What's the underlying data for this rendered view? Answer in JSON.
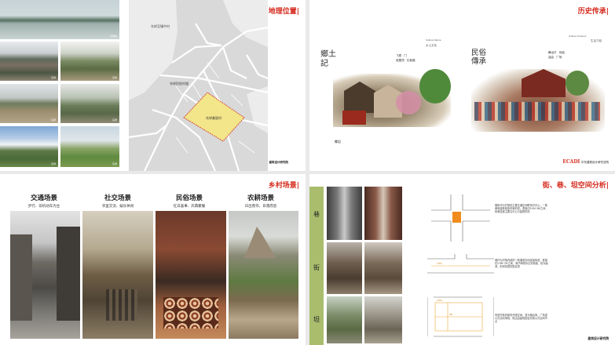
{
  "location": {
    "title": "地理位置|",
    "map_labels": {
      "district_top": "东祥至镇中村",
      "district_mid": "东祥民俗村道",
      "village": "东祥美丽村"
    },
    "logo": "建筑设计研究院",
    "photo_captions": [
      "东祥村",
      "东祥",
      "东祥",
      "东祥",
      "东祥",
      "东祥",
      "东祥"
    ]
  },
  "history": {
    "title": "历史传承|",
    "left_calligraphy": "鄉土記",
    "right_calligraphy": "民俗傳承",
    "left_note": "乡土文化",
    "right_note": "生活习俗",
    "left_heading": "Culture Nature",
    "right_heading": "Culture Customs",
    "left_items": [
      "飞檐",
      "门",
      "坡屋顶",
      "石板路"
    ],
    "right_items": [
      "舞龙灯",
      "戏曲",
      "庙会",
      "广场"
    ],
    "footer_left": "鄉記",
    "logo_brand": "ECADI",
    "logo_text": "华东建筑设计研究总院"
  },
  "scenes": {
    "title": "乡村场景|",
    "columns": [
      {
        "head": "交通场景",
        "sub": "步行、非机动车为主"
      },
      {
        "head": "社交场景",
        "sub": "邻里交流、娱乐休闲"
      },
      {
        "head": "民俗场景",
        "sub": "红白喜事、庆典聚餐"
      },
      {
        "head": "农耕场景",
        "sub": "日出而作，日落而息"
      }
    ]
  },
  "spaces": {
    "title": "街、巷、坦空间分析|",
    "labels": [
      "巷",
      "街",
      "坦"
    ],
    "texts": [
      "横街作为村落的主要交通空间联系村中心，一般两侧建筑临街布局形成。宽度约3.0M~5M之间，街巷连接主要沿中心与建筑形成",
      "巷作为村落内部的一般通道空间连接街道，宽度在0.9M~2M之间，巷子两侧为住宅墙面，较为幽深，形成较强的围合感",
      "坦是村落内部的开敞空间，常为晒谷场、广场或公共活动场地，周边由建筑围合形成公共空间节点"
    ],
    "dims": [
      "2.5M",
      "3.0M",
      "5M"
    ],
    "logo": "建筑设计研究院"
  }
}
